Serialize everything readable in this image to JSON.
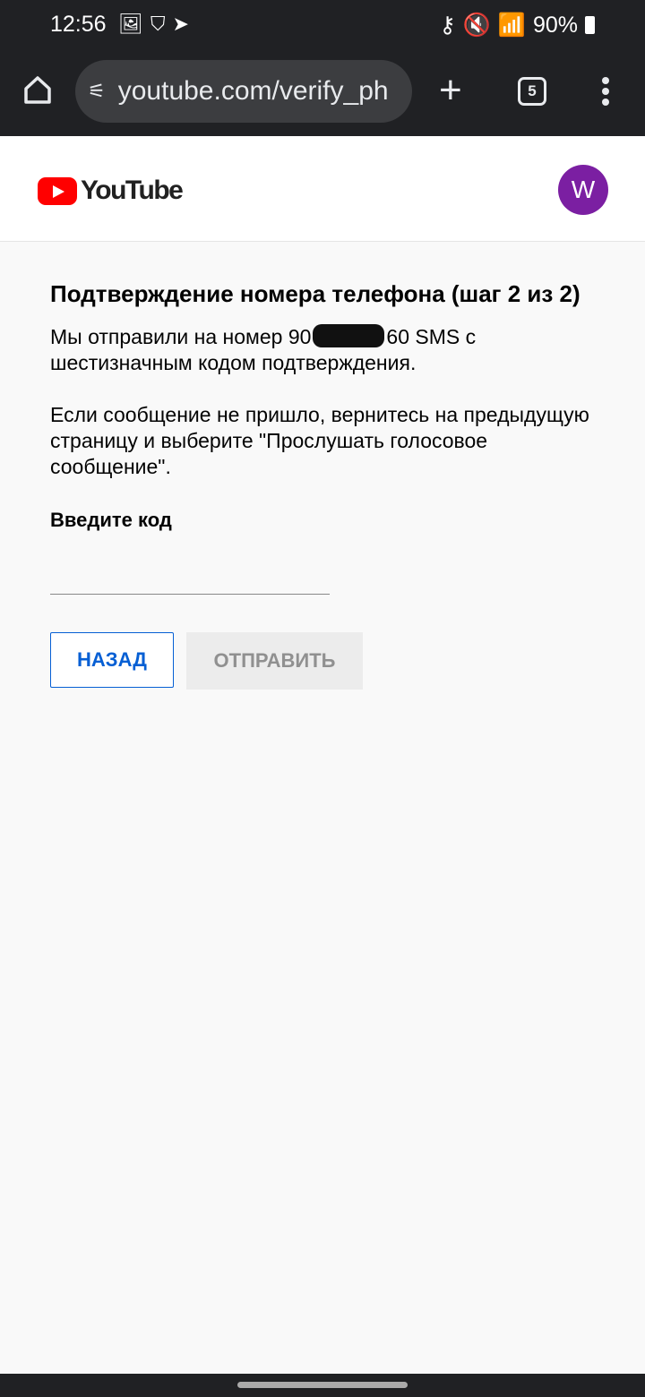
{
  "status": {
    "time": "12:56",
    "battery": "90%",
    "left_icons": [
      "gallery-icon",
      "shield-check-icon",
      "telegram-icon"
    ],
    "right_icons": [
      "key-icon",
      "mute-icon",
      "wifi-icon",
      "signal-icon",
      "battery-icon"
    ]
  },
  "browser": {
    "url": "youtube.com/verify_ph",
    "tab_count": "5"
  },
  "header": {
    "logo": "YouTube",
    "avatar_letter": "W",
    "brand_color": "#ff0000",
    "avatar_color": "#7b1fa2"
  },
  "main": {
    "title": "Подтверждение номера телефона (шаг 2 из 2)",
    "sms_prefix": "Мы отправили на номер 90",
    "sms_suffix": "60 SMS с шестизначным кодом подтверждения.",
    "help": "Если сообщение не пришло, вернитесь на предыдущую страницу и выберите \"Прослушать голосовое сообщение\".",
    "code_label": "Введите код",
    "code_value": "",
    "back_label": "НАЗАД",
    "submit_label": "ОТПРАВИТЬ"
  }
}
